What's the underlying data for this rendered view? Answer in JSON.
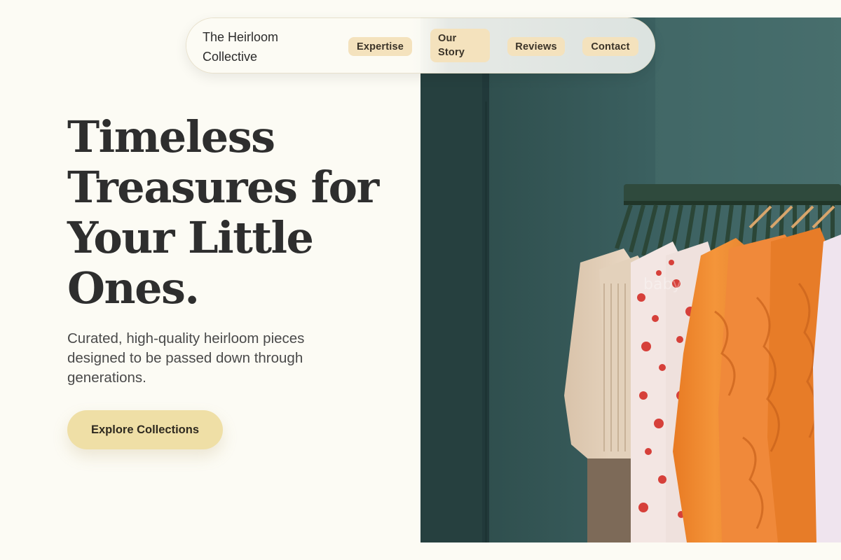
{
  "nav": {
    "brand": "The Heirloom Collective",
    "links": [
      {
        "label": "Expertise"
      },
      {
        "label": "Our Story"
      },
      {
        "label": "Reviews"
      },
      {
        "label": "Contact"
      }
    ]
  },
  "hero": {
    "headline": "Timeless Treasures for Your Little Ones.",
    "subtitle": "Curated, high-quality heirloom pieces designed to be passed down through generations.",
    "cta_label": "Explore Collections",
    "image_watermark": "baby"
  },
  "colors": {
    "background": "#fcfbf4",
    "nav_link_bg": "#f4e2bd",
    "cta_bg": "#efdfa6",
    "headline": "#2e2e2e",
    "photo_wall": "#3c6262"
  }
}
